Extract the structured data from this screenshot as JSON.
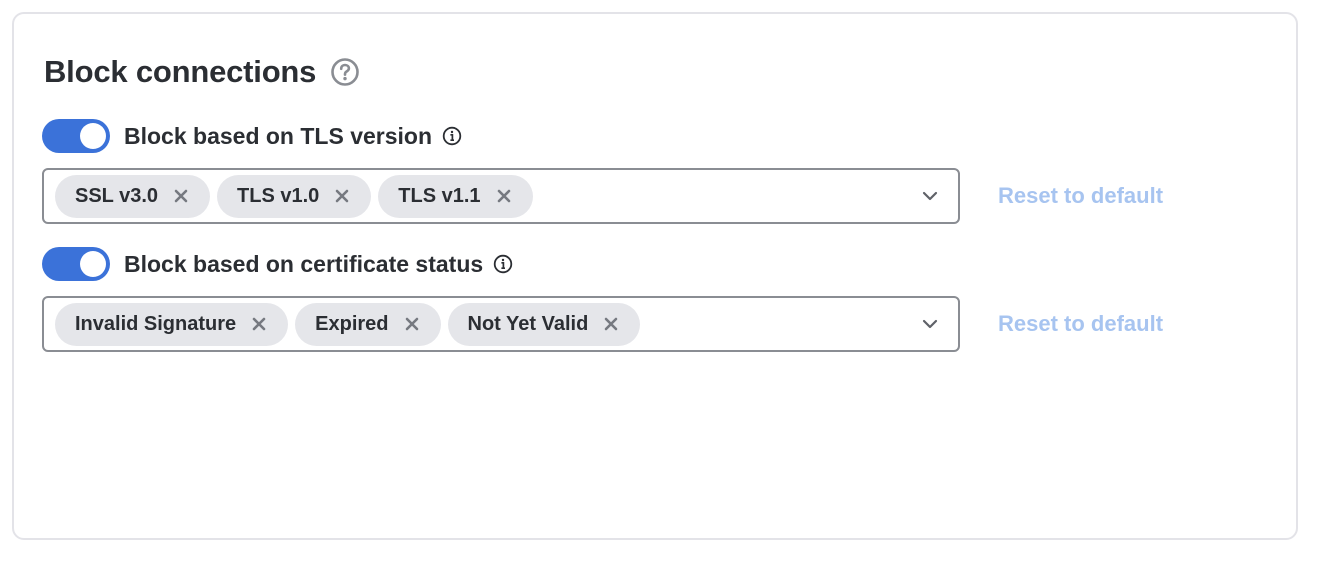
{
  "panel": {
    "title": "Block connections",
    "help_icon": "question-circle-icon"
  },
  "tls_section": {
    "toggle_on": true,
    "label": "Block based on TLS version",
    "info_icon": "info-circle-icon",
    "chips": [
      {
        "label": "SSL v3.0",
        "remove_icon": "close-icon"
      },
      {
        "label": "TLS v1.0",
        "remove_icon": "close-icon"
      },
      {
        "label": "TLS v1.1",
        "remove_icon": "close-icon"
      }
    ],
    "dropdown_icon": "chevron-down-icon",
    "reset_label": "Reset to default"
  },
  "cert_section": {
    "toggle_on": true,
    "label": "Block based on certificate status",
    "info_icon": "info-circle-icon",
    "chips": [
      {
        "label": "Invalid Signature",
        "remove_icon": "close-icon"
      },
      {
        "label": "Expired",
        "remove_icon": "close-icon"
      },
      {
        "label": "Not Yet Valid",
        "remove_icon": "close-icon"
      }
    ],
    "dropdown_icon": "chevron-down-icon",
    "reset_label": "Reset to default"
  },
  "colors": {
    "toggle_on": "#3b72d9",
    "reset_link_disabled": "#a7c4f0",
    "chip_bg": "#e5e6ea",
    "text": "#2b2e33"
  }
}
